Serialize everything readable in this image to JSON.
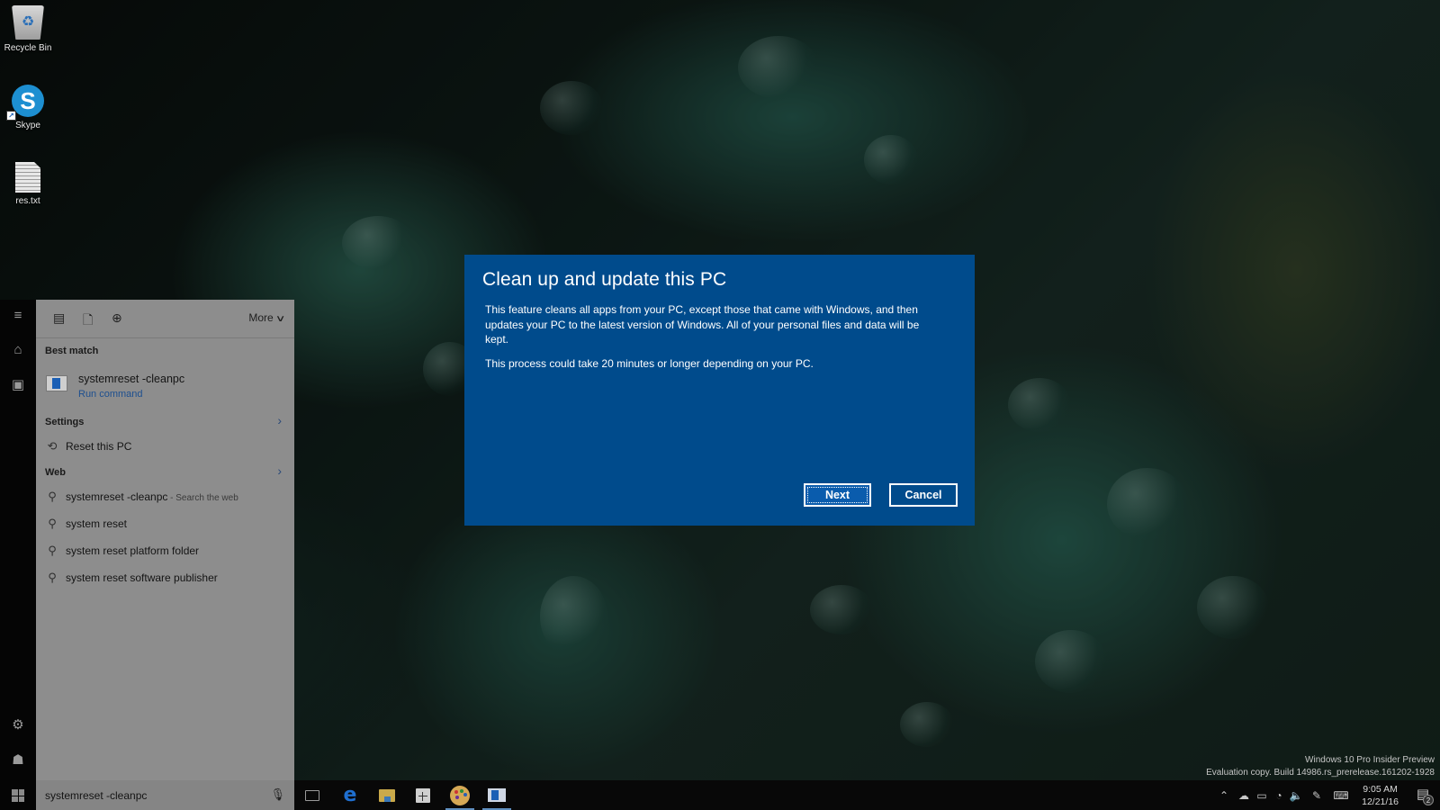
{
  "desktop": {
    "icons": [
      {
        "label": "Recycle Bin",
        "icon": "recycle-bin-icon"
      },
      {
        "label": "Skype",
        "icon": "skype-icon"
      },
      {
        "label": "res.txt",
        "icon": "text-file-icon"
      }
    ]
  },
  "start_rail": {
    "items": [
      {
        "icon": "hamburger-menu-icon",
        "glyph": "≡"
      },
      {
        "icon": "home-icon",
        "glyph": "⌂"
      },
      {
        "icon": "notebook-icon",
        "glyph": "▣"
      },
      {
        "icon": "settings-gear-icon",
        "glyph": "⚙"
      },
      {
        "icon": "feedback-icon",
        "glyph": "☗"
      }
    ]
  },
  "search_panel": {
    "filters": [
      {
        "icon": "apps-filter-icon",
        "glyph": "▤"
      },
      {
        "icon": "documents-filter-icon",
        "glyph": "🗋"
      },
      {
        "icon": "web-filter-icon",
        "glyph": "⊕"
      }
    ],
    "more_label": "More",
    "best_match_header": "Best match",
    "best_match": {
      "title": "systemreset -cleanpc",
      "subtitle": "Run command"
    },
    "settings_header": "Settings",
    "settings_items": [
      {
        "label": "Reset this PC",
        "icon": "history-icon",
        "glyph": "⟲"
      }
    ],
    "web_header": "Web",
    "web_items": [
      {
        "label": "systemreset -cleanpc",
        "hint": " - Search the web"
      },
      {
        "label": "system reset",
        "hint": ""
      },
      {
        "label": "system reset platform folder",
        "hint": ""
      },
      {
        "label": "system reset software publisher",
        "hint": ""
      }
    ],
    "search_value": "systemreset -cleanpc"
  },
  "dialog": {
    "title": "Clean up and update this PC",
    "paragraphs": [
      "This feature cleans all apps from your PC, except those that came with Windows, and then updates your PC to the latest version of Windows. All of your personal files and data will be kept.",
      "This process could take 20 minutes or longer depending on your PC."
    ],
    "next_label": "Next",
    "cancel_label": "Cancel",
    "accent_color": "#004b8c"
  },
  "taskbar": {
    "apps": [
      {
        "name": "Task View",
        "icon": "task-view-icon"
      },
      {
        "name": "Microsoft Edge",
        "icon": "edge-icon"
      },
      {
        "name": "File Explorer",
        "icon": "file-explorer-icon"
      },
      {
        "name": "Store",
        "icon": "store-icon"
      },
      {
        "name": "Paint",
        "icon": "paint-icon",
        "running": true
      },
      {
        "name": "Run command",
        "icon": "run-command-icon",
        "running": true
      }
    ],
    "tray": {
      "chevron": "^",
      "time": "9:05 AM",
      "date": "12/21/16",
      "notification_count": "2"
    }
  },
  "watermark": {
    "line1": "Windows 10 Pro Insider Preview",
    "line2": "Evaluation copy. Build 14986.rs_prerelease.161202-1928"
  }
}
